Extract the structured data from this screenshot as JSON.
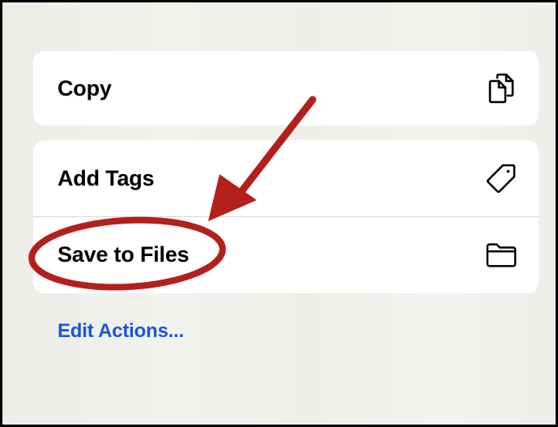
{
  "menu": {
    "copy_label": "Copy",
    "add_tags_label": "Add Tags",
    "save_to_files_label": "Save to Files",
    "edit_actions_label": "Edit Actions..."
  },
  "icons": {
    "copy": "copy-icon",
    "tag": "tag-icon",
    "folder": "folder-icon"
  },
  "annotation": {
    "arrow_color": "#b3201c",
    "highlight_target": "Save to Files"
  },
  "colors": {
    "link_blue": "#1a55d8",
    "card_background": "#ffffff",
    "sheet_background": "#eff0eb"
  }
}
